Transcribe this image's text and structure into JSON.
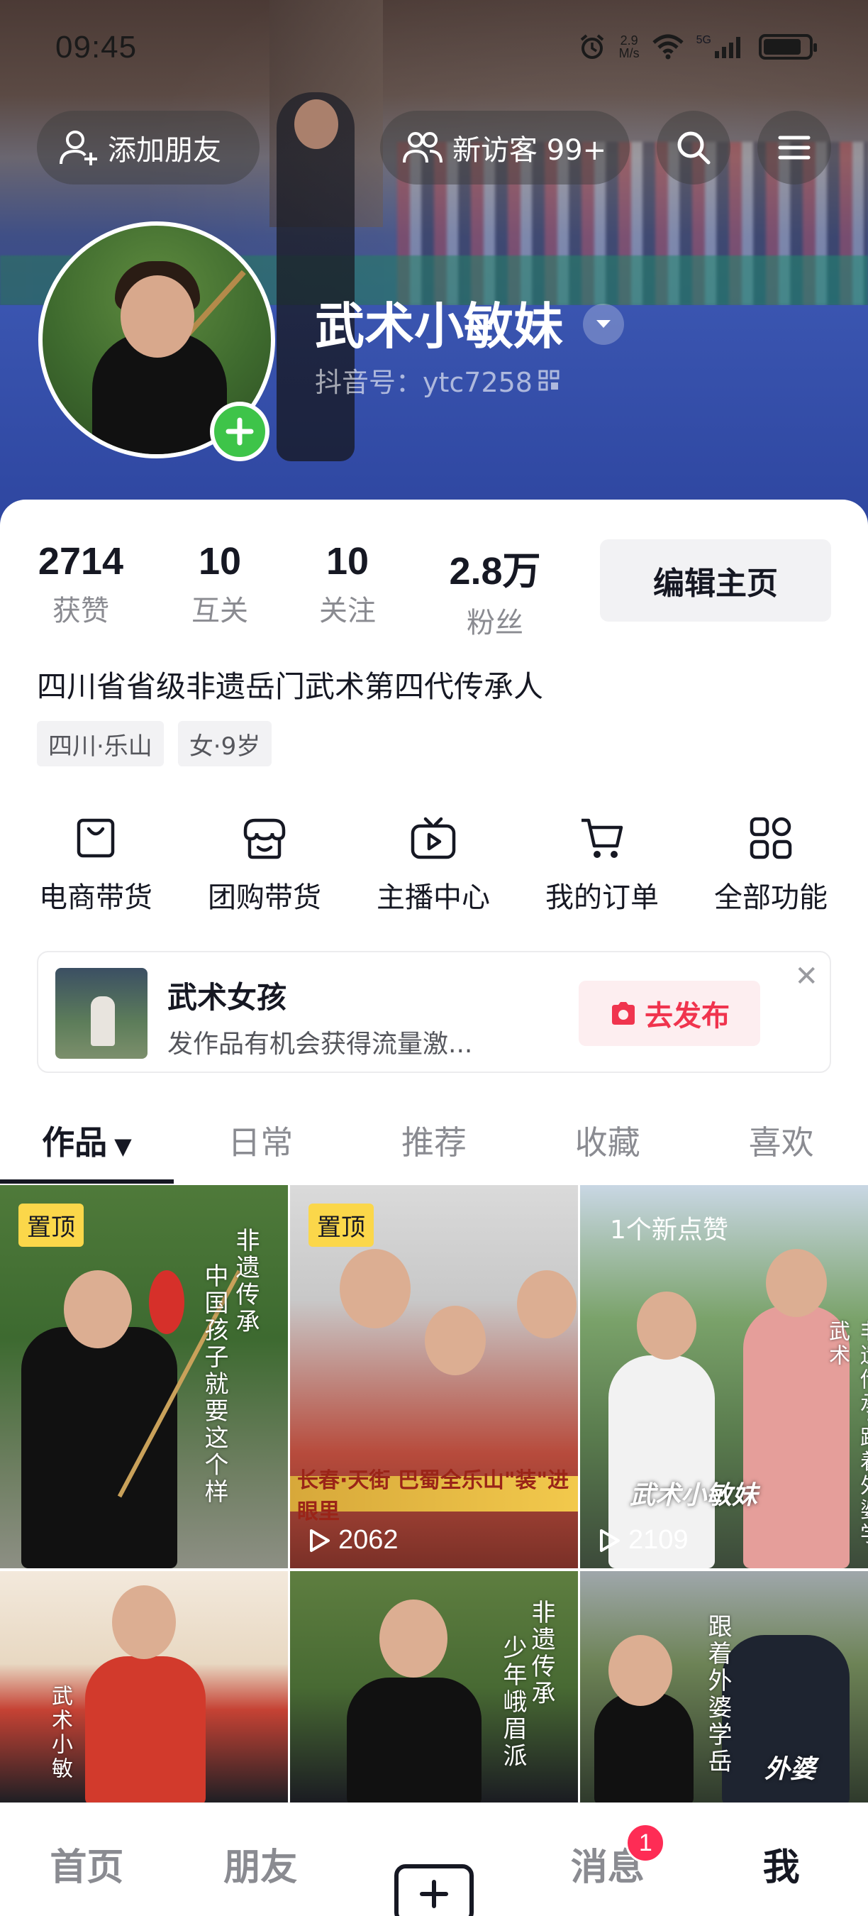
{
  "status_bar": {
    "time": "09:45",
    "network_speed": "2.9",
    "network_unit": "M/s",
    "network_type": "5G",
    "icons": [
      "alarm-icon",
      "wifi-icon",
      "signal-icon",
      "battery-icon"
    ]
  },
  "header": {
    "add_friend_label": "添加朋友",
    "visitors_label": "新访客 99+",
    "search_icon": "search-icon",
    "menu_icon": "menu-icon"
  },
  "profile": {
    "nickname": "武术小敏妹",
    "douyin_id": "抖音号：ytc7258",
    "bio": "四川省省级非遗岳门武术第四代传承人",
    "tags": [
      "四川·乐山",
      "女·9岁"
    ],
    "edit_button": "编辑主页"
  },
  "stats": [
    {
      "value": "2714",
      "label": "获赞"
    },
    {
      "value": "10",
      "label": "互关"
    },
    {
      "value": "10",
      "label": "关注"
    },
    {
      "value": "2.8万",
      "label": "粉丝"
    }
  ],
  "features": [
    {
      "label": "电商带货",
      "icon": "shopping-bag-icon"
    },
    {
      "label": "团购带货",
      "icon": "store-icon"
    },
    {
      "label": "主播中心",
      "icon": "tv-play-icon"
    },
    {
      "label": "我的订单",
      "icon": "cart-icon"
    },
    {
      "label": "全部功能",
      "icon": "grid-apps-icon"
    }
  ],
  "publish_prompt": {
    "title": "武术女孩",
    "subtitle": "发作品有机会获得流量激...",
    "button": "去发布"
  },
  "tabs": [
    "作品",
    "日常",
    "推荐",
    "收藏",
    "喜欢"
  ],
  "active_tab": "作品",
  "videos": [
    {
      "badge": "置顶",
      "overlay_text": [
        "非遗传承",
        "中国孩子就要这个样"
      ]
    },
    {
      "badge": "置顶",
      "plays": "2062",
      "caption": "长春·天街  巴蜀全乐山\"装\"进眼里"
    },
    {
      "new_likes": "1个新点赞",
      "plays": "2109",
      "signature": "武术小敏妹",
      "overlay_text": [
        "非遗传承·跟着外婆学武术"
      ]
    },
    {
      "overlay_text": [
        "武术小敏"
      ]
    },
    {
      "overlay_text": [
        "非遗传承",
        "少年峨眉派"
      ]
    },
    {
      "overlay_text": [
        "跟着外婆学岳"
      ],
      "signature": "外婆"
    }
  ],
  "bottom_nav": {
    "home": "首页",
    "friends": "朋友",
    "messages": "消息",
    "messages_badge": "1",
    "me": "我"
  }
}
